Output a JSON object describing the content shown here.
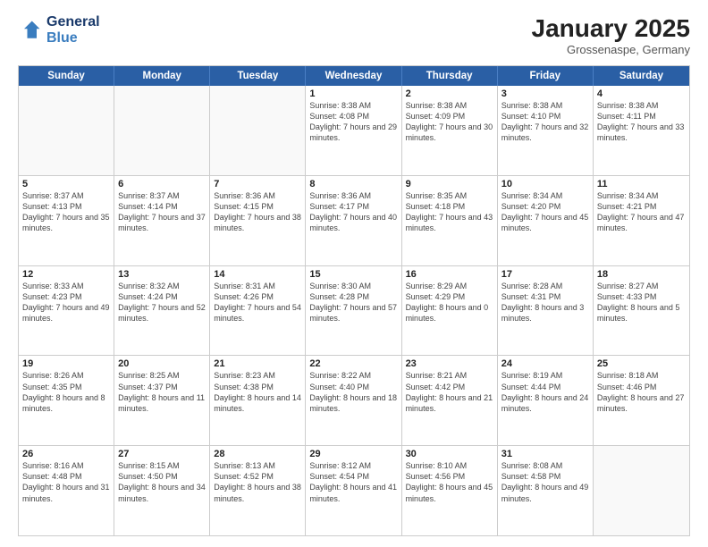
{
  "logo": {
    "line1": "General",
    "line2": "Blue"
  },
  "title": "January 2025",
  "subtitle": "Grossenaspe, Germany",
  "day_headers": [
    "Sunday",
    "Monday",
    "Tuesday",
    "Wednesday",
    "Thursday",
    "Friday",
    "Saturday"
  ],
  "weeks": [
    [
      {
        "day": "",
        "info": ""
      },
      {
        "day": "",
        "info": ""
      },
      {
        "day": "",
        "info": ""
      },
      {
        "day": "1",
        "info": "Sunrise: 8:38 AM\nSunset: 4:08 PM\nDaylight: 7 hours and 29 minutes."
      },
      {
        "day": "2",
        "info": "Sunrise: 8:38 AM\nSunset: 4:09 PM\nDaylight: 7 hours and 30 minutes."
      },
      {
        "day": "3",
        "info": "Sunrise: 8:38 AM\nSunset: 4:10 PM\nDaylight: 7 hours and 32 minutes."
      },
      {
        "day": "4",
        "info": "Sunrise: 8:38 AM\nSunset: 4:11 PM\nDaylight: 7 hours and 33 minutes."
      }
    ],
    [
      {
        "day": "5",
        "info": "Sunrise: 8:37 AM\nSunset: 4:13 PM\nDaylight: 7 hours and 35 minutes."
      },
      {
        "day": "6",
        "info": "Sunrise: 8:37 AM\nSunset: 4:14 PM\nDaylight: 7 hours and 37 minutes."
      },
      {
        "day": "7",
        "info": "Sunrise: 8:36 AM\nSunset: 4:15 PM\nDaylight: 7 hours and 38 minutes."
      },
      {
        "day": "8",
        "info": "Sunrise: 8:36 AM\nSunset: 4:17 PM\nDaylight: 7 hours and 40 minutes."
      },
      {
        "day": "9",
        "info": "Sunrise: 8:35 AM\nSunset: 4:18 PM\nDaylight: 7 hours and 43 minutes."
      },
      {
        "day": "10",
        "info": "Sunrise: 8:34 AM\nSunset: 4:20 PM\nDaylight: 7 hours and 45 minutes."
      },
      {
        "day": "11",
        "info": "Sunrise: 8:34 AM\nSunset: 4:21 PM\nDaylight: 7 hours and 47 minutes."
      }
    ],
    [
      {
        "day": "12",
        "info": "Sunrise: 8:33 AM\nSunset: 4:23 PM\nDaylight: 7 hours and 49 minutes."
      },
      {
        "day": "13",
        "info": "Sunrise: 8:32 AM\nSunset: 4:24 PM\nDaylight: 7 hours and 52 minutes."
      },
      {
        "day": "14",
        "info": "Sunrise: 8:31 AM\nSunset: 4:26 PM\nDaylight: 7 hours and 54 minutes."
      },
      {
        "day": "15",
        "info": "Sunrise: 8:30 AM\nSunset: 4:28 PM\nDaylight: 7 hours and 57 minutes."
      },
      {
        "day": "16",
        "info": "Sunrise: 8:29 AM\nSunset: 4:29 PM\nDaylight: 8 hours and 0 minutes."
      },
      {
        "day": "17",
        "info": "Sunrise: 8:28 AM\nSunset: 4:31 PM\nDaylight: 8 hours and 3 minutes."
      },
      {
        "day": "18",
        "info": "Sunrise: 8:27 AM\nSunset: 4:33 PM\nDaylight: 8 hours and 5 minutes."
      }
    ],
    [
      {
        "day": "19",
        "info": "Sunrise: 8:26 AM\nSunset: 4:35 PM\nDaylight: 8 hours and 8 minutes."
      },
      {
        "day": "20",
        "info": "Sunrise: 8:25 AM\nSunset: 4:37 PM\nDaylight: 8 hours and 11 minutes."
      },
      {
        "day": "21",
        "info": "Sunrise: 8:23 AM\nSunset: 4:38 PM\nDaylight: 8 hours and 14 minutes."
      },
      {
        "day": "22",
        "info": "Sunrise: 8:22 AM\nSunset: 4:40 PM\nDaylight: 8 hours and 18 minutes."
      },
      {
        "day": "23",
        "info": "Sunrise: 8:21 AM\nSunset: 4:42 PM\nDaylight: 8 hours and 21 minutes."
      },
      {
        "day": "24",
        "info": "Sunrise: 8:19 AM\nSunset: 4:44 PM\nDaylight: 8 hours and 24 minutes."
      },
      {
        "day": "25",
        "info": "Sunrise: 8:18 AM\nSunset: 4:46 PM\nDaylight: 8 hours and 27 minutes."
      }
    ],
    [
      {
        "day": "26",
        "info": "Sunrise: 8:16 AM\nSunset: 4:48 PM\nDaylight: 8 hours and 31 minutes."
      },
      {
        "day": "27",
        "info": "Sunrise: 8:15 AM\nSunset: 4:50 PM\nDaylight: 8 hours and 34 minutes."
      },
      {
        "day": "28",
        "info": "Sunrise: 8:13 AM\nSunset: 4:52 PM\nDaylight: 8 hours and 38 minutes."
      },
      {
        "day": "29",
        "info": "Sunrise: 8:12 AM\nSunset: 4:54 PM\nDaylight: 8 hours and 41 minutes."
      },
      {
        "day": "30",
        "info": "Sunrise: 8:10 AM\nSunset: 4:56 PM\nDaylight: 8 hours and 45 minutes."
      },
      {
        "day": "31",
        "info": "Sunrise: 8:08 AM\nSunset: 4:58 PM\nDaylight: 8 hours and 49 minutes."
      },
      {
        "day": "",
        "info": ""
      }
    ]
  ]
}
